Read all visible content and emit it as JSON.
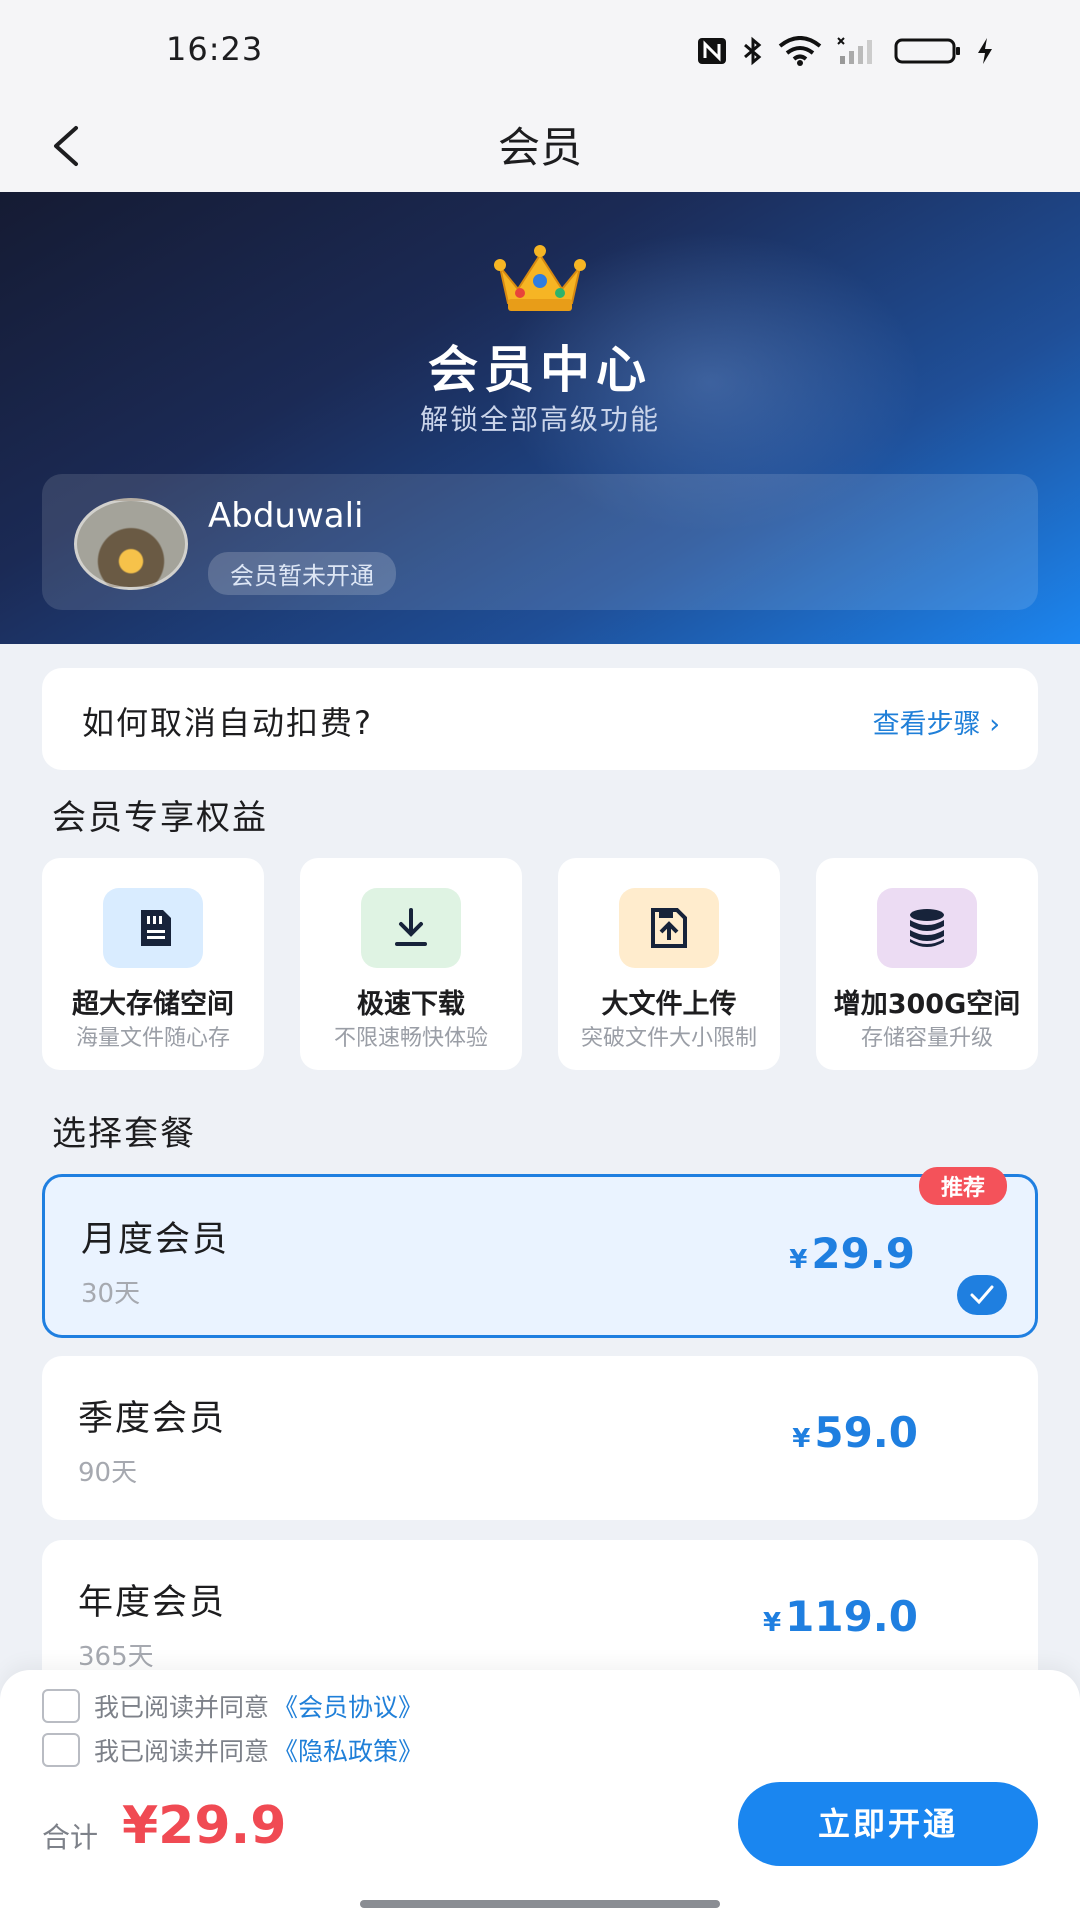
{
  "status_bar": {
    "time": "16:23"
  },
  "nav": {
    "title": "会员"
  },
  "hero": {
    "title": "会员中心",
    "subtitle": "解锁全部高级功能",
    "user": {
      "name": "Abduwali",
      "status": "会员暂未开通"
    }
  },
  "cancel_help": {
    "text": "如何取消自动扣费?",
    "link": "查看步骤 ›"
  },
  "benefits": {
    "title": "会员专享权益",
    "items": [
      {
        "title": "超大存储空间",
        "subtitle": "海量文件随心存",
        "icon": "sd-card-icon",
        "color": "#d9ecff"
      },
      {
        "title": "极速下载",
        "subtitle": "不限速畅快体验",
        "icon": "download-icon",
        "color": "#dff3e3"
      },
      {
        "title": "大文件上传",
        "subtitle": "突破文件大小限制",
        "icon": "upload-file-icon",
        "color": "#ffeccd"
      },
      {
        "title": "增加300G空间",
        "subtitle": "存储容量升级",
        "icon": "database-icon",
        "color": "#ecdcf3"
      }
    ]
  },
  "plans": {
    "title": "选择套餐",
    "items": [
      {
        "name": "月度会员",
        "days": "30天",
        "currency": "¥",
        "price": "29.9",
        "badge": "推荐",
        "selected": true
      },
      {
        "name": "季度会员",
        "days": "90天",
        "currency": "¥",
        "price": "59.0",
        "selected": false
      },
      {
        "name": "年度会员",
        "days": "365天",
        "currency": "¥",
        "price": "119.0",
        "selected": false
      }
    ]
  },
  "agreements": [
    {
      "text": "我已阅读并同意",
      "link": "《会员协议》"
    },
    {
      "text": "我已阅读并同意",
      "link": "《隐私政策》"
    }
  ],
  "footer": {
    "total_label": "合计",
    "total_amount": "¥29.9",
    "button": "立即开通"
  },
  "colors": {
    "accent": "#1f7fe0",
    "price_red": "#f04a53",
    "badge_red": "#f4525a"
  }
}
